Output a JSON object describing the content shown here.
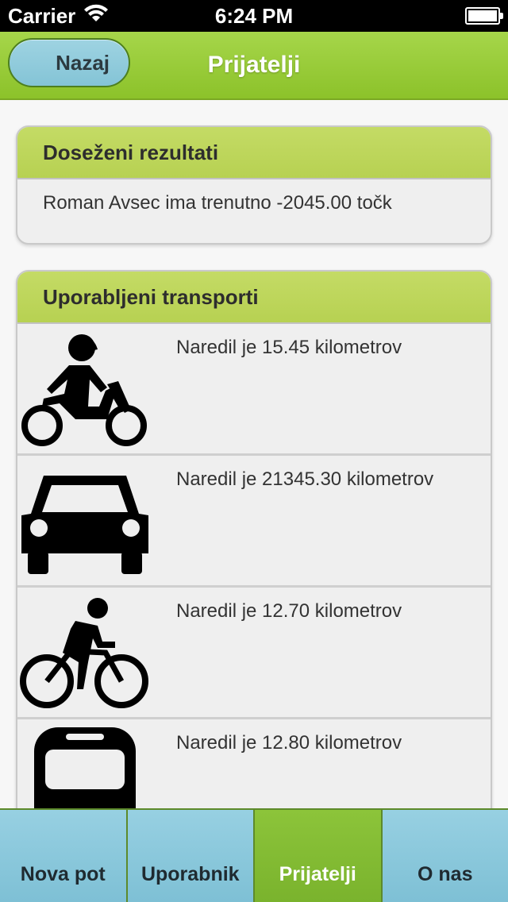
{
  "status_bar": {
    "carrier": "Carrier",
    "time": "6:24 PM"
  },
  "nav": {
    "back_label": "Nazaj",
    "title": "Prijatelji"
  },
  "results": {
    "header": "Doseženi rezultati",
    "text": "Roman Avsec ima trenutno -2045.00 točk"
  },
  "transports": {
    "header": "Uporabljeni transporti",
    "items": [
      {
        "icon": "motorcycle-icon",
        "text": "Naredil je 15.45 kilometrov"
      },
      {
        "icon": "car-icon",
        "text": "Naredil je 21345.30 kilometrov"
      },
      {
        "icon": "bicycle-icon",
        "text": "Naredil je 12.70 kilometrov"
      },
      {
        "icon": "bus-icon",
        "text": "Naredil je 12.80 kilometrov"
      }
    ]
  },
  "tabs": [
    {
      "label": "Nova pot",
      "active": false
    },
    {
      "label": "Uporabnik",
      "active": false
    },
    {
      "label": "Prijatelji",
      "active": true
    },
    {
      "label": "O nas",
      "active": false
    }
  ],
  "colors": {
    "accent": "#8cc22a",
    "tab": "#84c4d6",
    "header": "#bcd55a"
  }
}
